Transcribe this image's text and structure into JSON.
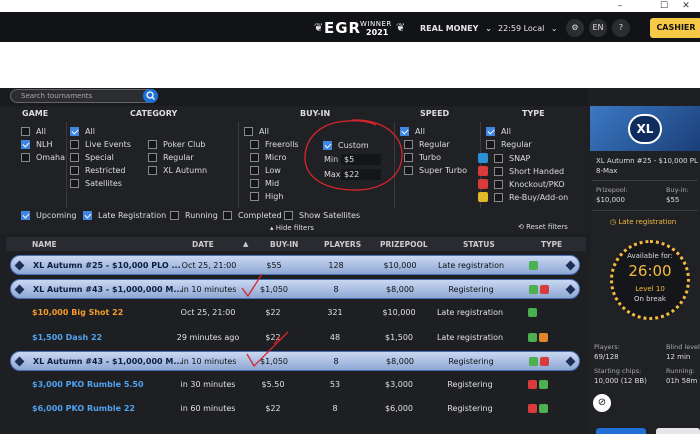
{
  "window": {
    "minimize": "–",
    "maximize": "☐",
    "close": "✕"
  },
  "topbar": {
    "egr_big": "EGR",
    "egr_winner": "WINNER",
    "egr_year": "2021",
    "money_mode": "REAL MONEY",
    "time": "22:59 Local",
    "language": "EN",
    "help": "?",
    "cashier": "CASHIER"
  },
  "search": {
    "placeholder": "Search tournaments"
  },
  "filters": {
    "headers": {
      "game": "GAME",
      "category": "CATEGORY",
      "buyin": "BUY-IN",
      "speed": "SPEED",
      "type": "TYPE"
    },
    "game": [
      {
        "label": "All",
        "checked": false
      },
      {
        "label": "NLH",
        "checked": true
      },
      {
        "label": "Omaha",
        "checked": false
      }
    ],
    "category_col1": [
      {
        "label": "All",
        "checked": true
      },
      {
        "label": "Live Events",
        "checked": false
      },
      {
        "label": "Special",
        "checked": false
      },
      {
        "label": "Restricted",
        "checked": false
      },
      {
        "label": "Satellites",
        "checked": false
      }
    ],
    "category_col2": [
      {
        "label": "Poker Club",
        "checked": false
      },
      {
        "label": "Regular",
        "checked": false
      },
      {
        "label": "XL Autumn",
        "checked": false
      }
    ],
    "buyin": [
      {
        "label": "All",
        "checked": false
      },
      {
        "label": "Freerolls",
        "checked": false
      },
      {
        "label": "Micro",
        "checked": false
      },
      {
        "label": "Low",
        "checked": false
      },
      {
        "label": "Mid",
        "checked": false
      },
      {
        "label": "High",
        "checked": false
      }
    ],
    "custom": {
      "label": "Custom",
      "checked": true,
      "min_label": "Min",
      "min_value": "$5",
      "max_label": "Max",
      "max_value": "$22"
    },
    "speed": [
      {
        "label": "All",
        "checked": true
      },
      {
        "label": "Regular",
        "checked": false
      },
      {
        "label": "Turbo",
        "checked": false
      },
      {
        "label": "Super Turbo",
        "checked": false
      }
    ],
    "type": [
      {
        "label": "All",
        "checked": true,
        "icon": ""
      },
      {
        "label": "Regular",
        "checked": false,
        "icon": ""
      },
      {
        "label": "SNAP",
        "checked": false,
        "icon": "snap-icon",
        "color": "#2b8fd6"
      },
      {
        "label": "Short Handed",
        "checked": false,
        "icon": "short-handed-icon",
        "color": "#d93a3a"
      },
      {
        "label": "Knockout/PKO",
        "checked": false,
        "icon": "knockout-icon",
        "color": "#d93a3a"
      },
      {
        "label": "Re-Buy/Add-on",
        "checked": false,
        "icon": "rebuy-icon",
        "color": "#e0b92b"
      }
    ],
    "options": [
      {
        "label": "Upcoming",
        "checked": true
      },
      {
        "label": "Late Registration",
        "checked": true
      },
      {
        "label": "Running",
        "checked": false
      },
      {
        "label": "Completed",
        "checked": false
      },
      {
        "label": "Show Satellites",
        "checked": false
      }
    ],
    "hide_filters": "Hide filters",
    "reset_filters": "Reset filters"
  },
  "table": {
    "columns": [
      "NAME",
      "DATE",
      "BUY-IN",
      "PLAYERS",
      "PRIZEPOOL",
      "STATUS",
      "TYPE"
    ],
    "rows": [
      {
        "name": "XL Autumn #25 - $10,000 PLO ...",
        "date": "Oct 25, 21:00",
        "buyin": "$55",
        "players": "128",
        "prizepool": "$10,000",
        "status": "Late registration",
        "highlight": true,
        "name_color": "#0c1d44",
        "badges": [
          "#4caf50"
        ]
      },
      {
        "name": "XL Autumn #43 - $1,000,000 M...",
        "date": "in 10 minutes",
        "buyin": "$1,050",
        "players": "8",
        "prizepool": "$8,000",
        "status": "Registering",
        "highlight": true,
        "name_color": "#0c1d44",
        "badges": [
          "#4caf50",
          "#d93a3a"
        ]
      },
      {
        "name": "$10,000 Big Shot 22",
        "date": "Oct 25, 21:00",
        "buyin": "$22",
        "players": "321",
        "prizepool": "$10,000",
        "status": "Late registration",
        "highlight": false,
        "name_color": "#f39a2b",
        "badges": [
          "#4caf50"
        ]
      },
      {
        "name": "$1,500 Dash 22",
        "date": "29 minutes ago",
        "buyin": "$22",
        "players": "48",
        "prizepool": "$1,500",
        "status": "Late registration",
        "highlight": false,
        "name_color": "#4fa3f0",
        "badges": [
          "#4caf50",
          "#e0872b"
        ]
      },
      {
        "name": "XL Autumn #43 - $1,000,000 M...",
        "date": "in 10 minutes",
        "buyin": "$1,050",
        "players": "8",
        "prizepool": "$8,000",
        "status": "Registering",
        "highlight": true,
        "name_color": "#0c1d44",
        "badges": [
          "#4caf50",
          "#d93a3a"
        ]
      },
      {
        "name": "$3,000 PKO Rumble 5.50",
        "date": "in 30 minutes",
        "buyin": "$5.50",
        "players": "53",
        "prizepool": "$3,000",
        "status": "Registering",
        "highlight": false,
        "name_color": "#4fa3f0",
        "badges": [
          "#d93a3a",
          "#4caf50"
        ]
      },
      {
        "name": "$6,000 PKO Rumble 22",
        "date": "in 60 minutes",
        "buyin": "$22",
        "players": "8",
        "prizepool": "$6,000",
        "status": "Registering",
        "highlight": false,
        "name_color": "#4fa3f0",
        "badges": [
          "#d93a3a",
          "#4caf50"
        ]
      }
    ]
  },
  "details": {
    "banner_logo": "XL",
    "title": "XL Autumn #25 - $10,000 PL",
    "subtitle": "8-Max",
    "prizepool_label": "Prizepool:",
    "prizepool_value": "$10,000",
    "buyin_label": "Buy-in:",
    "buyin_value": "$55",
    "late_reg": "Late registration",
    "available_label": "Available for:",
    "timer": "26:00",
    "level": "Level 10",
    "break_status": "On break",
    "players_label": "Players:",
    "players_value": "69/128",
    "blind_label": "Blind level",
    "blind_value": "12 min",
    "chips_label": "Starting chips:",
    "chips_value": "10,000 (12 BB)",
    "running_label": "Running:",
    "running_value": "01h 58m"
  },
  "colors": {
    "accent": "#3f86e0",
    "cashier": "#f7c948",
    "late_reg": "#f4b940",
    "annotation": "#d6262b"
  }
}
